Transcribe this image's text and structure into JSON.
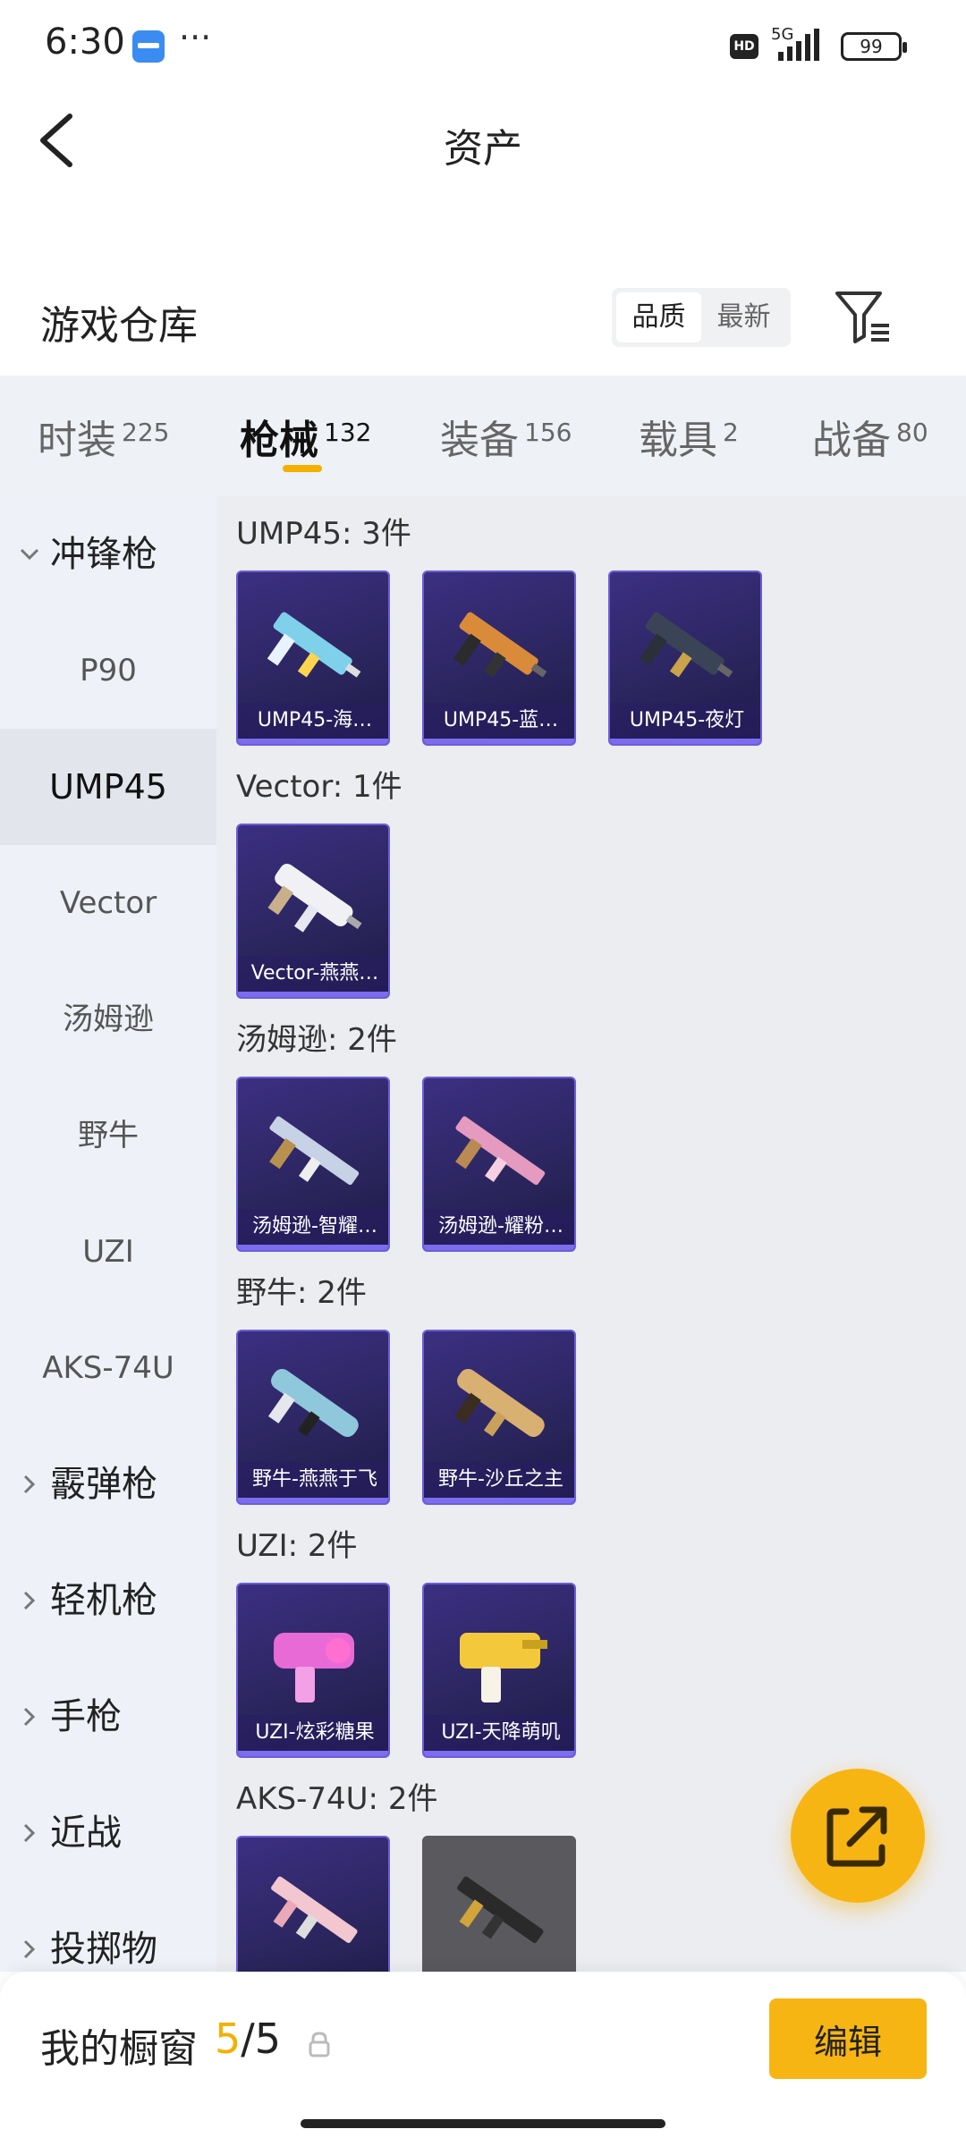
{
  "status_bar": {
    "time": "6:30",
    "network": "5G",
    "battery": "99"
  },
  "header": {
    "title": "资产"
  },
  "warehouse": {
    "title": "游戏仓库",
    "sort_quality": "品质",
    "sort_newest": "最新"
  },
  "tabs": [
    {
      "label": "时装",
      "count": "225"
    },
    {
      "label": "枪械",
      "count": "132"
    },
    {
      "label": "装备",
      "count": "156"
    },
    {
      "label": "载具",
      "count": "2"
    },
    {
      "label": "战备",
      "count": "80"
    }
  ],
  "sidebar": {
    "items": [
      {
        "label": "冲锋枪"
      },
      {
        "label": "P90"
      },
      {
        "label": "UMP45"
      },
      {
        "label": "Vector"
      },
      {
        "label": "汤姆逊"
      },
      {
        "label": "野牛"
      },
      {
        "label": "UZI"
      },
      {
        "label": "AKS-74U"
      },
      {
        "label": "霰弹枪"
      },
      {
        "label": "轻机枪"
      },
      {
        "label": "手枪"
      },
      {
        "label": "近战"
      },
      {
        "label": "投掷物"
      }
    ]
  },
  "groups": [
    {
      "title": "UMP45: 3件",
      "items": [
        {
          "name": "UMP45-海…"
        },
        {
          "name": "UMP45-蓝…"
        },
        {
          "name": "UMP45-夜灯"
        }
      ]
    },
    {
      "title": "Vector: 1件",
      "items": [
        {
          "name": "Vector-燕燕…"
        }
      ]
    },
    {
      "title": "汤姆逊: 2件",
      "items": [
        {
          "name": "汤姆逊-智耀…"
        },
        {
          "name": "汤姆逊-耀粉…"
        }
      ]
    },
    {
      "title": "野牛: 2件",
      "items": [
        {
          "name": "野牛-燕燕于飞"
        },
        {
          "name": "野牛-沙丘之主"
        }
      ]
    },
    {
      "title": "UZI: 2件",
      "items": [
        {
          "name": "UZI-炫彩糖果"
        },
        {
          "name": "UZI-天降萌叽"
        }
      ]
    },
    {
      "title": "AKS-74U: 2件"
    }
  ],
  "showcase": {
    "label": "我的橱窗",
    "current": "5",
    "sep": "/",
    "max": "5",
    "edit_label": "编辑"
  },
  "colors": {
    "accent": "#f4b000",
    "card_bg": "#2c2660",
    "card_border": "#6c5ed6"
  }
}
